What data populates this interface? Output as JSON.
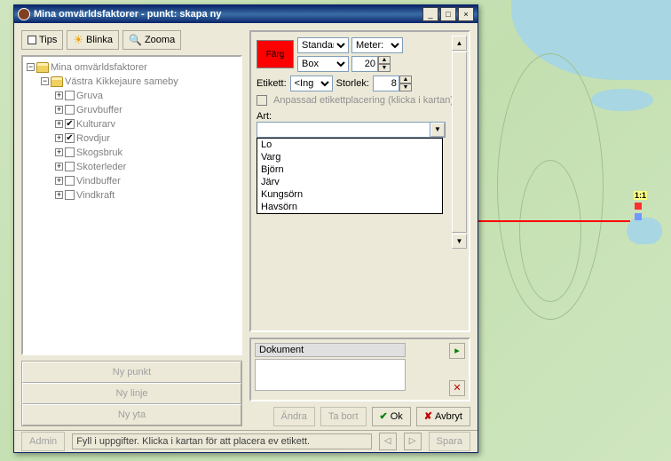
{
  "map": {
    "marker_label": "1:1"
  },
  "window": {
    "title": "Mina omvärldsfaktorer - punkt: skapa ny"
  },
  "toolbar": {
    "tips": "Tips",
    "blinka": "Blinka",
    "zooma": "Zooma"
  },
  "tree": {
    "root": "Mina omvärldsfaktorer",
    "group": "Västra Kikkejaure sameby",
    "items": [
      {
        "label": "Gruva",
        "checked": false
      },
      {
        "label": "Gruvbuffer",
        "checked": false
      },
      {
        "label": "Kulturarv",
        "checked": true
      },
      {
        "label": "Rovdjur",
        "checked": true
      },
      {
        "label": "Skogsbruk",
        "checked": false
      },
      {
        "label": "Skoterleder",
        "checked": false
      },
      {
        "label": "Vindbuffer",
        "checked": false
      },
      {
        "label": "Vindkraft",
        "checked": false
      }
    ]
  },
  "newbtns": {
    "punkt": "Ny punkt",
    "linje": "Ny linje",
    "yta": "Ny yta"
  },
  "props": {
    "farg_label": "Färg",
    "standar": "Standar",
    "meter": "Meter:",
    "box": "Box",
    "box_val": "20",
    "etikett": "Etikett:",
    "etikett_val": "<Ing",
    "storlek": "Storlek:",
    "storlek_val": "8",
    "anpassad": "Anpassad etikettplacering (klicka i kartan)",
    "art": "Art:",
    "art_value": "",
    "art_options": [
      "Lo",
      "Varg",
      "Björn",
      "Järv",
      "Kungsörn",
      "Havsörn"
    ]
  },
  "doc": {
    "header": "Dokument"
  },
  "buttons": {
    "andra": "Ändra",
    "tabort": "Ta bort",
    "ok": "Ok",
    "avbryt": "Avbryt",
    "admin": "Admin",
    "spara": "Spara"
  },
  "status": {
    "msg": "Fyll i uppgifter. Klicka i kartan för att placera ev etikett."
  }
}
